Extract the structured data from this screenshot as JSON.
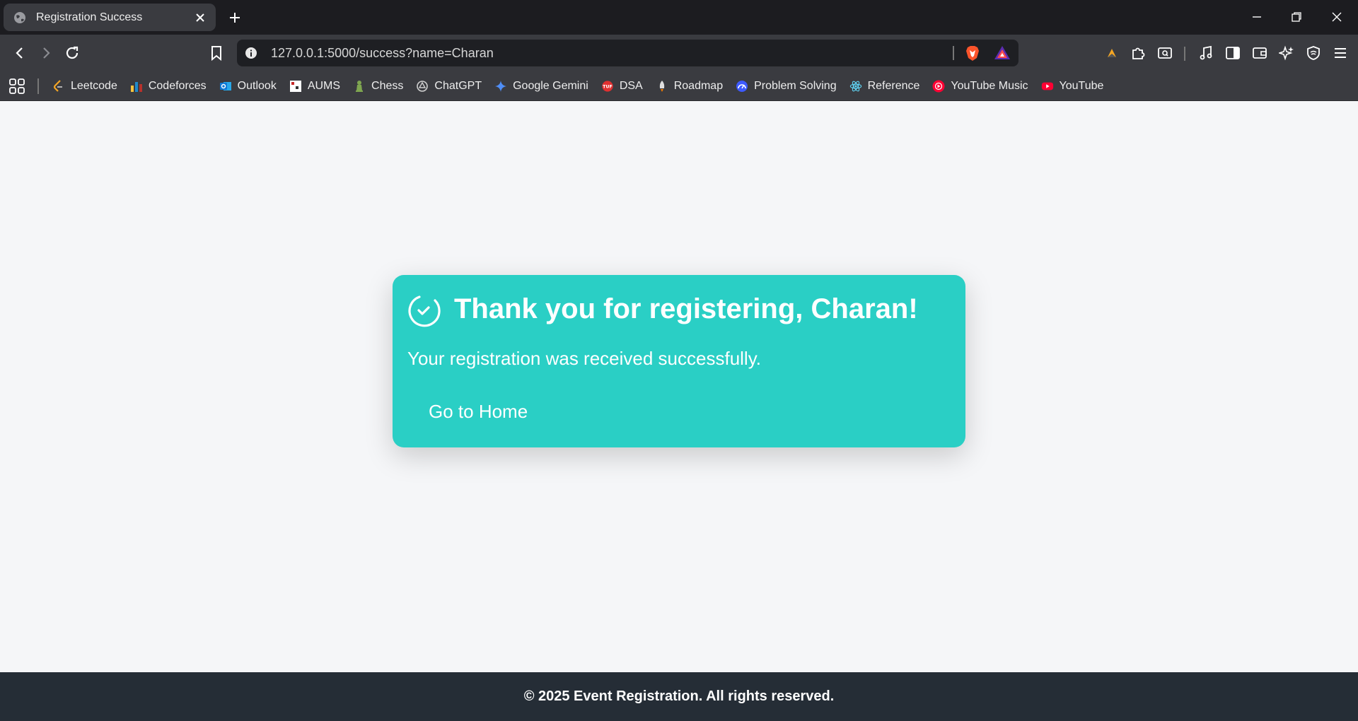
{
  "browser": {
    "tab": {
      "title": "Registration Success"
    },
    "address_bar": {
      "url": "127.0.0.1:5000/success?name=Charan"
    },
    "bookmarks": [
      {
        "label": "Leetcode",
        "icon": "leetcode-icon",
        "color": "#f5a623"
      },
      {
        "label": "Codeforces",
        "icon": "codeforces-icon",
        "color": "#1f8acb"
      },
      {
        "label": "Outlook",
        "icon": "outlook-icon",
        "color": "#0f78d4"
      },
      {
        "label": "AUMS",
        "icon": "aums-icon",
        "color": "#ffffff"
      },
      {
        "label": "Chess",
        "icon": "chess-icon",
        "color": "#7fa650"
      },
      {
        "label": "ChatGPT",
        "icon": "chatgpt-icon",
        "color": "#d0d0d0"
      },
      {
        "label": "Google Gemini",
        "icon": "gemini-icon",
        "color": "#4f8ef7"
      },
      {
        "label": "DSA",
        "icon": "dsa-icon",
        "color": "#e03030"
      },
      {
        "label": "Roadmap",
        "icon": "rocket-icon",
        "color": "#e0e0e0"
      },
      {
        "label": "Problem Solving",
        "icon": "problem-solving-icon",
        "color": "#3d5afe"
      },
      {
        "label": "Reference",
        "icon": "react-icon",
        "color": "#61dafb"
      },
      {
        "label": "YouTube Music",
        "icon": "youtube-music-icon",
        "color": "#ff0033"
      },
      {
        "label": "YouTube",
        "icon": "youtube-icon",
        "color": "#ff0033"
      }
    ]
  },
  "page": {
    "card": {
      "heading": "Thank you for registering, Charan!",
      "message": "Your registration was received successfully.",
      "home_button": "Go to Home",
      "color": "#2acfc5"
    },
    "footer": {
      "text": "© 2025 Event Registration. All rights reserved.",
      "color": "#252d36"
    }
  }
}
